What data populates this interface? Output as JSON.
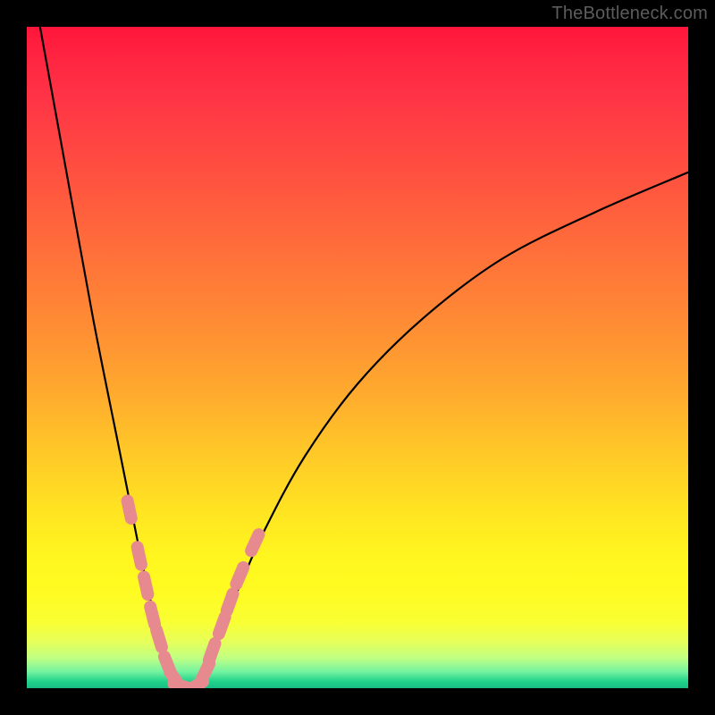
{
  "watermark": "TheBottleneck.com",
  "colors": {
    "frame": "#000000",
    "curve": "#000000",
    "marker": "#e78a8f",
    "gradient_stops": [
      "#ff153a",
      "#ff2340",
      "#ff3246",
      "#ff5040",
      "#ff6f3a",
      "#ff8c34",
      "#ffa92e",
      "#ffc728",
      "#ffe322",
      "#fff61f",
      "#fffb20",
      "#f9ff33",
      "#e6ff5a",
      "#bfff85",
      "#74f3a0",
      "#1fd28a",
      "#1abc83"
    ]
  },
  "chart_data": {
    "type": "line",
    "title": "",
    "xlabel": "",
    "ylabel": "",
    "xlim": [
      0,
      100
    ],
    "ylim": [
      0,
      100
    ],
    "note": "V-shaped bottleneck curve; y≈100 at left edge, reaches 0 near x≈22–25, rises back toward ~78 at right edge. Background color encodes bottleneck severity (red=high, green=low). Pink capsule markers cluster near the trough.",
    "series": [
      {
        "name": "bottleneck-curve-left",
        "x": [
          2,
          6,
          10,
          14,
          17,
          19,
          20.5,
          22,
          23.5
        ],
        "y": [
          100,
          78,
          56,
          36,
          21,
          12,
          6,
          2,
          0
        ]
      },
      {
        "name": "bottleneck-curve-right",
        "x": [
          25.5,
          27,
          29,
          32,
          36,
          42,
          50,
          60,
          72,
          86,
          100
        ],
        "y": [
          0,
          3,
          8,
          15,
          24,
          35,
          46,
          56,
          65,
          72,
          78
        ]
      }
    ],
    "markers": [
      {
        "approx_x": 15.5,
        "approx_y": 27
      },
      {
        "approx_x": 17.0,
        "approx_y": 20
      },
      {
        "approx_x": 18.0,
        "approx_y": 15.5
      },
      {
        "approx_x": 19.0,
        "approx_y": 11
      },
      {
        "approx_x": 20.0,
        "approx_y": 7.5
      },
      {
        "approx_x": 21.3,
        "approx_y": 3.5
      },
      {
        "approx_x": 22.5,
        "approx_y": 1.2
      },
      {
        "approx_x": 23.5,
        "approx_y": 0.3
      },
      {
        "approx_x": 25.5,
        "approx_y": 0.3
      },
      {
        "approx_x": 27.0,
        "approx_y": 2.5
      },
      {
        "approx_x": 28.0,
        "approx_y": 5.5
      },
      {
        "approx_x": 29.5,
        "approx_y": 9.5
      },
      {
        "approx_x": 30.7,
        "approx_y": 13
      },
      {
        "approx_x": 32.2,
        "approx_y": 17
      },
      {
        "approx_x": 34.5,
        "approx_y": 22
      }
    ]
  }
}
